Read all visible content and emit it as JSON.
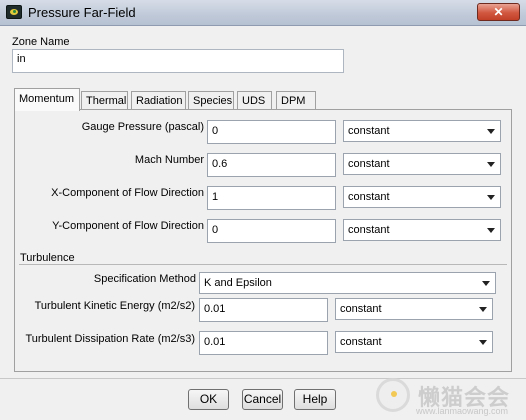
{
  "window": {
    "title": "Pressure Far-Field",
    "close_glyph": "✕"
  },
  "zone": {
    "label": "Zone Name",
    "value": "in"
  },
  "tabs": [
    {
      "label": "Momentum",
      "active": true
    },
    {
      "label": "Thermal"
    },
    {
      "label": "Radiation"
    },
    {
      "label": "Species"
    },
    {
      "label": "UDS"
    },
    {
      "label": "DPM"
    }
  ],
  "momentum": {
    "fields": [
      {
        "label": "Gauge Pressure (pascal)",
        "value": "0",
        "method": "constant"
      },
      {
        "label": "Mach Number",
        "value": "0.6",
        "method": "constant"
      },
      {
        "label": "X-Component of Flow Direction",
        "value": "1",
        "method": "constant"
      },
      {
        "label": "Y-Component of Flow Direction",
        "value": "0",
        "method": "constant"
      }
    ]
  },
  "turbulence": {
    "label": "Turbulence",
    "spec_label": "Specification Method",
    "spec_value": "K and Epsilon",
    "fields": [
      {
        "label": "Turbulent Kinetic Energy (m2/s2)",
        "value": "0.01",
        "method": "constant"
      },
      {
        "label": "Turbulent Dissipation Rate (m2/s3)",
        "value": "0.01",
        "method": "constant"
      }
    ]
  },
  "buttons": {
    "ok": "OK",
    "cancel": "Cancel",
    "help": "Help"
  },
  "watermark": {
    "chars": "懒猫会会",
    "url": "www.lanmaowang.com"
  },
  "icons": [
    "app-icon",
    "close-icon",
    "dropdown-arrow-icon"
  ],
  "colors": {
    "titlebar": "#c4cddb",
    "close": "#d1573f",
    "panel_bg": "#f0f0f0"
  }
}
